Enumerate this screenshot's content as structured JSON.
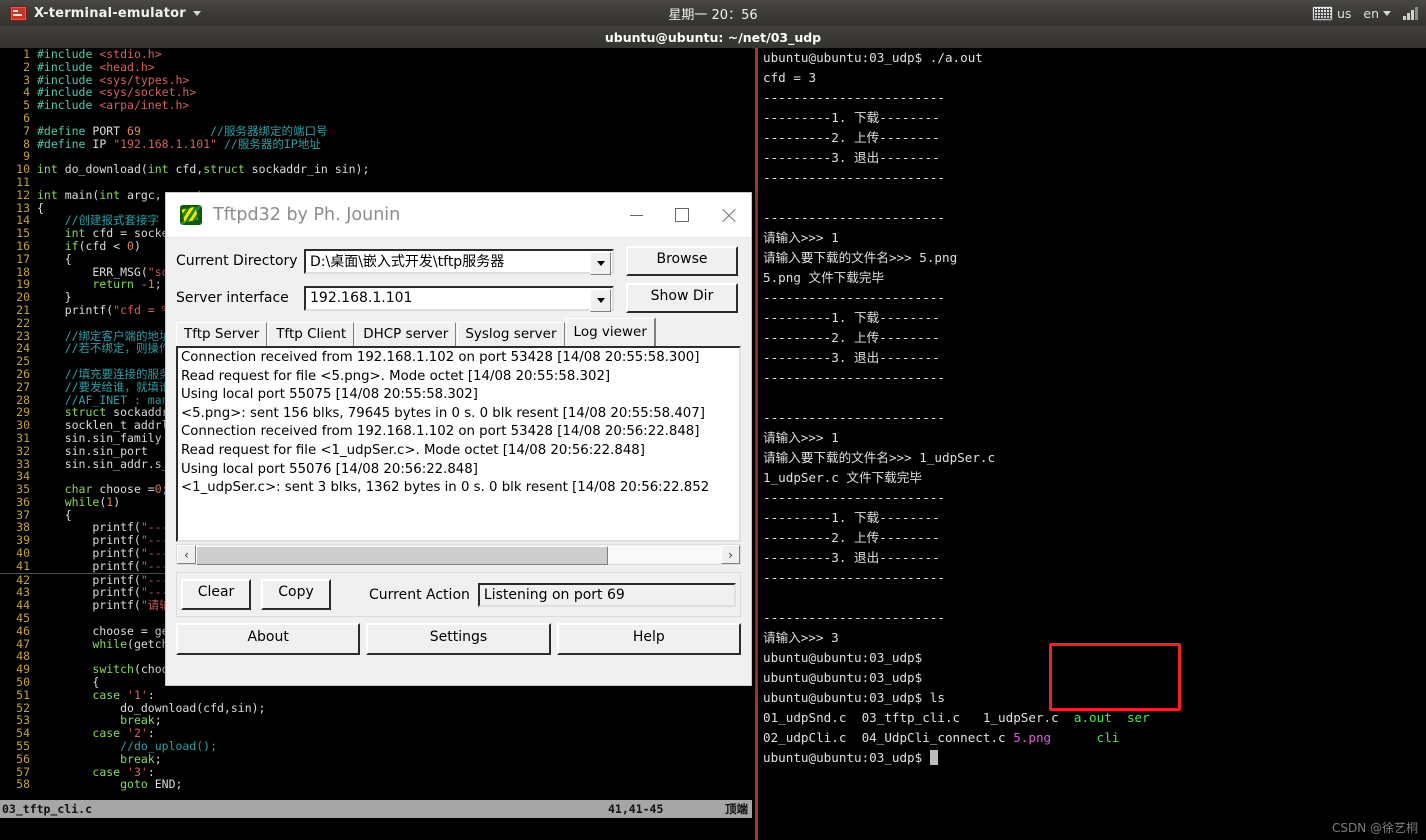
{
  "topbar": {
    "app_name": "X-terminal-emulator",
    "app_icon": "terminal-icon",
    "clock_day": "星期一",
    "clock_time": "20：56",
    "keyboard_layout": "us",
    "language": "en"
  },
  "terminal_window": {
    "title": "ubuntu@ubuntu: ~/net/03_udp"
  },
  "editor": {
    "filename": "03_tftp_cli.c",
    "position": "41,41-45",
    "scroll_state": "顶端",
    "cursor_line": 41,
    "lines": [
      {
        "n": 1,
        "html": "<span class='c-pre'>#include</span> <span class='c-str'>&lt;stdio.h&gt;</span>"
      },
      {
        "n": 2,
        "html": "<span class='c-pre'>#include</span> <span class='c-str'>&lt;head.h&gt;</span>"
      },
      {
        "n": 3,
        "html": "<span class='c-pre'>#include</span> <span class='c-str'>&lt;sys/types.h&gt;</span>"
      },
      {
        "n": 4,
        "html": "<span class='c-pre'>#include</span> <span class='c-str'>&lt;sys/socket.h&gt;</span>"
      },
      {
        "n": 5,
        "html": "<span class='c-pre'>#include</span> <span class='c-str'>&lt;arpa/inet.h&gt;</span>"
      },
      {
        "n": 6,
        "html": ""
      },
      {
        "n": 7,
        "html": "<span class='c-pre'>#define</span> <span class='c-id'>PORT</span> <span class='c-num'>69</span>          <span class='c-cmt'>//服务器绑定的端口号</span>"
      },
      {
        "n": 8,
        "html": "<span class='c-pre'>#define</span> <span class='c-id'>IP</span> <span class='c-str'>\"192.168.1.101\"</span> <span class='c-cmt'>//服务器的IP地址</span>"
      },
      {
        "n": 9,
        "html": ""
      },
      {
        "n": 10,
        "html": "<span class='c-kw'>int</span> do_download(<span class='c-kw'>int</span> cfd,<span class='c-kw'>struct</span> sockaddr_in sin);"
      },
      {
        "n": 11,
        "html": ""
      },
      {
        "n": 12,
        "html": "<span class='c-kw'>int</span> main(<span class='c-kw'>int</span> argc, <span class='c-kw'>const</span>"
      },
      {
        "n": 13,
        "html": "{"
      },
      {
        "n": 14,
        "html": "    <span class='c-cmt'>//创建报式套接字</span>"
      },
      {
        "n": 15,
        "html": "    <span class='c-kw'>int</span> cfd = socket(AF_"
      },
      {
        "n": 16,
        "html": "    <span class='c-kw'>if</span>(cfd &lt; <span class='c-num'>0</span>)"
      },
      {
        "n": 17,
        "html": "    {"
      },
      {
        "n": 18,
        "html": "        ERR_MSG(<span class='c-str'>\"socket\"</span>"
      },
      {
        "n": 19,
        "html": "        <span class='c-kw'>return</span> <span class='c-num'>-1</span>;"
      },
      {
        "n": 20,
        "html": "    }"
      },
      {
        "n": 21,
        "html": "    printf(<span class='c-str'>\"cfd = %d\\n\"</span>"
      },
      {
        "n": 22,
        "html": ""
      },
      {
        "n": 23,
        "html": "    <span class='c-cmt'>//绑定客户端的地址信</span>"
      },
      {
        "n": 24,
        "html": "    <span class='c-cmt'>//若不绑定，则操作系</span>"
      },
      {
        "n": 25,
        "html": ""
      },
      {
        "n": 26,
        "html": "    <span class='c-cmt'>//填充要连接的服务器</span>"
      },
      {
        "n": 27,
        "html": "    <span class='c-cmt'>//要发给谁，就填谁的</span>"
      },
      {
        "n": 28,
        "html": "    <span class='c-cmt'>//AF_INET : man 7 ip</span>"
      },
      {
        "n": 29,
        "html": "    <span class='c-kw'>struct</span> sockaddr_in s"
      },
      {
        "n": 30,
        "html": "    socklen_t addrlen=si"
      },
      {
        "n": 31,
        "html": "    sin.sin_family"
      },
      {
        "n": 32,
        "html": "    sin.sin_port"
      },
      {
        "n": 33,
        "html": "    sin.sin_addr.s_addr"
      },
      {
        "n": 34,
        "html": ""
      },
      {
        "n": 35,
        "html": "    <span class='c-kw'>char</span> choose =<span class='c-num'>0</span>;"
      },
      {
        "n": 36,
        "html": "    <span class='c-kw'>while</span>(<span class='c-num'>1</span>)"
      },
      {
        "n": 37,
        "html": "    {"
      },
      {
        "n": 38,
        "html": "        printf(<span class='c-str'>\"------</span>"
      },
      {
        "n": 39,
        "html": "        printf(<span class='c-str'>\"------</span>"
      },
      {
        "n": 40,
        "html": "        printf(<span class='c-str'>\"------</span>"
      },
      {
        "n": 41,
        "html": "        printf(<span class='c-str'>\"------</span>"
      },
      {
        "n": 42,
        "html": "        printf(<span class='c-str'>\"------</span>"
      },
      {
        "n": 43,
        "html": "        printf(<span class='c-str'>\"------</span>"
      },
      {
        "n": 44,
        "html": "        printf(<span class='c-str'>\"请输入&gt;</span>"
      },
      {
        "n": 45,
        "html": ""
      },
      {
        "n": 46,
        "html": "        choose = getchar"
      },
      {
        "n": 47,
        "html": "        <span class='c-kw'>while</span>(getchar()"
      },
      {
        "n": 48,
        "html": ""
      },
      {
        "n": 49,
        "html": "        <span class='c-kw'>switch</span>(choose)"
      },
      {
        "n": 50,
        "html": "        {"
      },
      {
        "n": 51,
        "html": "        <span class='c-kw'>case</span> <span class='c-str'>'1'</span>:"
      },
      {
        "n": 52,
        "html": "            do_download(cfd,sin);"
      },
      {
        "n": 53,
        "html": "            <span class='c-kw'>break</span>;"
      },
      {
        "n": 54,
        "html": "        <span class='c-kw'>case</span> <span class='c-str'>'2'</span>:"
      },
      {
        "n": 55,
        "html": "            <span class='c-cmt'>//do_upload();</span>"
      },
      {
        "n": 56,
        "html": "            <span class='c-kw'>break</span>;"
      },
      {
        "n": 57,
        "html": "        <span class='c-kw'>case</span> <span class='c-str'>'3'</span>:"
      },
      {
        "n": 58,
        "html": "            <span class='c-kw'>goto</span> END;"
      }
    ]
  },
  "tftpd": {
    "window_title": "Tftpd32 by Ph. Jounin",
    "minimize_label": "minimize",
    "maximize_label": "maximize",
    "close_label": "close",
    "current_directory_label": "Current Directory",
    "current_directory_value": "D:\\桌面\\嵌入式开发\\tftp服务器",
    "server_interface_label": "Server interface",
    "server_interface_value": "192.168.1.101",
    "browse_label": "Browse",
    "show_dir_label": "Show Dir",
    "tabs": [
      {
        "label": "Tftp Server",
        "active": false
      },
      {
        "label": "Tftp Client",
        "active": false
      },
      {
        "label": "DHCP server",
        "active": false
      },
      {
        "label": "Syslog server",
        "active": false
      },
      {
        "label": "Log viewer",
        "active": true
      }
    ],
    "log_lines": [
      "Connection received from 192.168.1.102 on port 53428 [14/08 20:55:58.300]",
      "Read request for file <5.png>. Mode octet [14/08 20:55:58.302]",
      "Using local port 55075 [14/08 20:55:58.302]",
      "<5.png>: sent 156 blks, 79645 bytes in 0 s. 0 blk resent [14/08 20:55:58.407]",
      "Connection received from 192.168.1.102 on port 53428 [14/08 20:56:22.848]",
      "Read request for file <1_udpSer.c>. Mode octet [14/08 20:56:22.848]",
      "Using local port 55076 [14/08 20:56:22.848]",
      "<1_udpSer.c>: sent 3 blks, 1362 bytes in 0 s. 0 blk resent [14/08 20:56:22.852"
    ],
    "scroll_left_icon": "‹",
    "scroll_right_icon": "›",
    "clear_label": "Clear",
    "copy_label": "Copy",
    "current_action_label": "Current Action",
    "current_action_value": "Listening on port 69",
    "about_label": "About",
    "settings_label": "Settings",
    "help_label": "Help"
  },
  "right_terminal": {
    "lines": [
      [
        {
          "t": "ubuntu@ubuntu:03_udp$ ./a.out",
          "c": "t-white"
        }
      ],
      [
        {
          "t": "cfd = 3",
          "c": "t-white"
        }
      ],
      [
        {
          "t": "------------------------",
          "c": "t-white"
        }
      ],
      [
        {
          "t": "---------1. 下载--------",
          "c": "t-white"
        }
      ],
      [
        {
          "t": "---------2. 上传--------",
          "c": "t-white"
        }
      ],
      [
        {
          "t": "---------3. 退出--------",
          "c": "t-white"
        }
      ],
      [
        {
          "t": "------------------------",
          "c": "t-white"
        }
      ],
      [
        {
          "t": "",
          "c": "t-white"
        }
      ],
      [
        {
          "t": "------------------------",
          "c": "t-white"
        }
      ],
      [
        {
          "t": "请输入>>> 1",
          "c": "t-white"
        }
      ],
      [
        {
          "t": "请输入要下载的文件名>>> 5.png",
          "c": "t-white"
        }
      ],
      [
        {
          "t": "5.png 文件下载完毕",
          "c": "t-white"
        }
      ],
      [
        {
          "t": "------------------------",
          "c": "t-white"
        }
      ],
      [
        {
          "t": "---------1. 下载--------",
          "c": "t-white"
        }
      ],
      [
        {
          "t": "---------2. 上传--------",
          "c": "t-white"
        }
      ],
      [
        {
          "t": "---------3. 退出--------",
          "c": "t-white"
        }
      ],
      [
        {
          "t": "------------------------",
          "c": "t-white"
        }
      ],
      [
        {
          "t": "",
          "c": "t-white"
        }
      ],
      [
        {
          "t": "------------------------",
          "c": "t-white"
        }
      ],
      [
        {
          "t": "请输入>>> 1",
          "c": "t-white"
        }
      ],
      [
        {
          "t": "请输入要下载的文件名>>> 1_udpSer.c",
          "c": "t-white"
        }
      ],
      [
        {
          "t": "1_udpSer.c 文件下载完毕",
          "c": "t-white"
        }
      ],
      [
        {
          "t": "------------------------",
          "c": "t-white"
        }
      ],
      [
        {
          "t": "---------1. 下载--------",
          "c": "t-white"
        }
      ],
      [
        {
          "t": "---------2. 上传--------",
          "c": "t-white"
        }
      ],
      [
        {
          "t": "---------3. 退出--------",
          "c": "t-white"
        }
      ],
      [
        {
          "t": "------------------------",
          "c": "t-white"
        }
      ],
      [
        {
          "t": "",
          "c": "t-white"
        }
      ],
      [
        {
          "t": "------------------------",
          "c": "t-white"
        }
      ],
      [
        {
          "t": "请输入>>> 3",
          "c": "t-white"
        }
      ],
      [
        {
          "t": "ubuntu@ubuntu:03_udp$",
          "c": "t-white"
        }
      ],
      [
        {
          "t": "ubuntu@ubuntu:03_udp$",
          "c": "t-white"
        }
      ],
      [
        {
          "t": "ubuntu@ubuntu:03_udp$ ls",
          "c": "t-white"
        }
      ],
      [
        {
          "t": "01_udpSnd.c  03_tftp_cli.c   1_udpSer.c  ",
          "c": "t-white"
        },
        {
          "t": "a.out  ser",
          "c": "t-green"
        }
      ],
      [
        {
          "t": "02_udpCli.c  04_UdpCli_connect.c ",
          "c": "t-white"
        },
        {
          "t": "5.png",
          "c": "t-pink"
        },
        {
          "t": "      ",
          "c": "t-white"
        },
        {
          "t": "cli",
          "c": "t-green"
        }
      ],
      [
        {
          "t": "ubuntu@ubuntu:03_udp$ ",
          "c": "t-white"
        },
        {
          "t": "█",
          "c": "cursor"
        }
      ]
    ],
    "highlight_box": {
      "files": [
        "1_udpSer.c",
        "5.png"
      ],
      "color": "#ee2222"
    }
  },
  "watermark": "CSDN @徐艺桐"
}
